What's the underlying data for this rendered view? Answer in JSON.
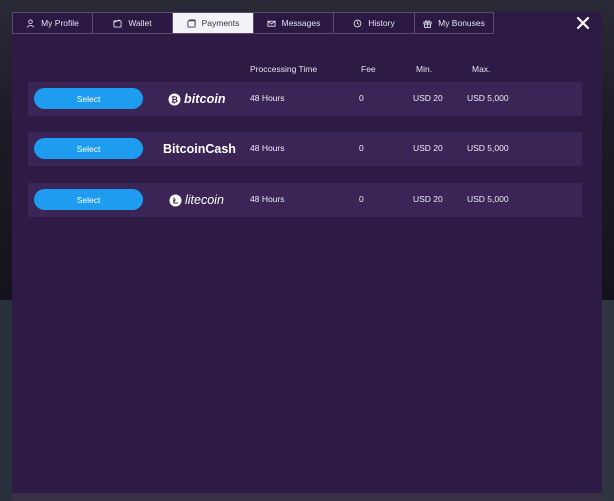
{
  "tabs": [
    {
      "label": "My Profile",
      "icon": "user-icon",
      "active": false
    },
    {
      "label": "Wallet",
      "icon": "wallet-icon",
      "active": false
    },
    {
      "label": "Payments",
      "icon": "card-icon",
      "active": true
    },
    {
      "label": "Messages",
      "icon": "envelope-icon",
      "active": false
    },
    {
      "label": "History",
      "icon": "clock-icon",
      "active": false
    },
    {
      "label": "My Bonuses",
      "icon": "gift-icon",
      "active": false
    }
  ],
  "columns": {
    "processing": "Proccessing Time",
    "fee": "Fee",
    "min": "Min.",
    "max": "Max."
  },
  "methods": [
    {
      "select_label": "Select",
      "logo_text": "bitcoin",
      "logo_icon": "bitcoin-icon",
      "processing": "48 Hours",
      "fee": "0",
      "min": "USD 20",
      "max": "USD 5,000"
    },
    {
      "select_label": "Select",
      "logo_text": "BitcoinCash",
      "logo_icon": "",
      "processing": "48 Hours",
      "fee": "0",
      "min": "USD 20",
      "max": "USD 5,000"
    },
    {
      "select_label": "Select",
      "logo_text": "litecoin",
      "logo_icon": "litecoin-icon",
      "processing": "48 Hours",
      "fee": "0",
      "min": "USD 20",
      "max": "USD 5,000"
    }
  ],
  "colors": {
    "modal_bg": "#2d1a45",
    "row_bg": "#3b2456",
    "button": "#1e9cf0",
    "active_tab": "#f3f2f6"
  }
}
